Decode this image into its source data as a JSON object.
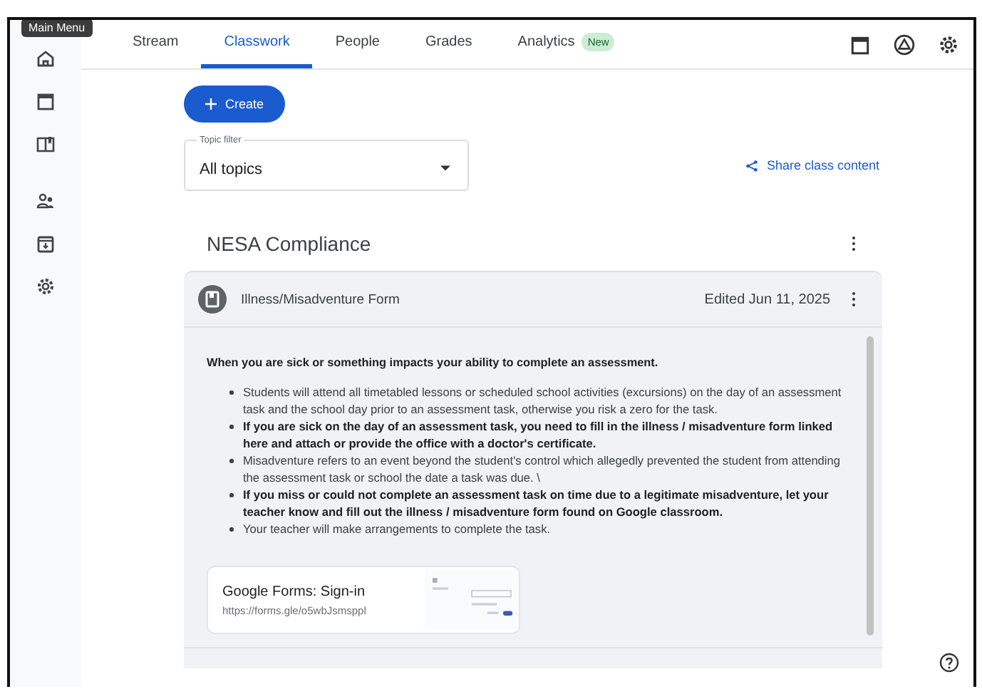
{
  "tooltip": "Main Menu",
  "tabs": [
    {
      "label": "Stream",
      "selected": false
    },
    {
      "label": "Classwork",
      "selected": true
    },
    {
      "label": "People",
      "selected": false
    },
    {
      "label": "Grades",
      "selected": false
    },
    {
      "label": "Analytics",
      "selected": false,
      "badge": "New"
    }
  ],
  "create_button": "Create",
  "topic_filter": {
    "label": "Topic filter",
    "value": "All topics"
  },
  "share_link": "Share class content",
  "topic": {
    "title": "NESA Compliance",
    "material": {
      "title": "Illness/Misadventure Form",
      "edited": "Edited Jun 11, 2025",
      "intro": "When you are sick or something impacts your ability to complete an assessment.",
      "bullets": [
        {
          "text": "Students will attend all timetabled lessons or scheduled school activities (excursions) on the day of an assessment task and the school day prior to an assessment task, otherwise you risk a zero for the task.",
          "bold": false
        },
        {
          "text": "If you are sick on the day of an assessment task, you need to fill in the illness / misadventure form linked here and attach or provide the office with a doctor's certificate.",
          "bold": true
        },
        {
          "text": "Misadventure refers to an event beyond the student's control which allegedly prevented the student from attending the assessment task or school the date a task was due. \\",
          "bold": false
        },
        {
          "text": "If you miss or could not complete an assessment task on time due to a legitimate misadventure, let your teacher know and fill out the illness / misadventure form found on Google classroom.",
          "bold": true
        },
        {
          "text": "Your teacher will make arrangements to complete the task.",
          "bold": false
        }
      ],
      "attachment": {
        "title": "Google Forms: Sign-in",
        "url": "https://forms.gle/o5wbJsmsppl"
      }
    }
  }
}
